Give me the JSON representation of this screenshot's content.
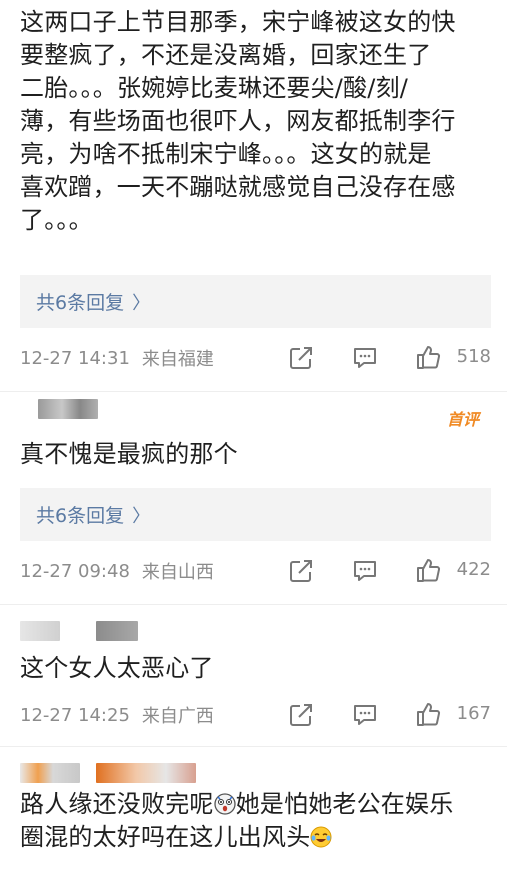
{
  "comments": [
    {
      "text_lines": [
        "这两口子上节目那季，宋宁峰被这女的快",
        "要整疯了，不还是没离婚，回家还生了",
        "二胎。。。张婉婷比麦琳还要尖/酸/刻/",
        "薄，有些场面也很吓人，网友都抵制李行",
        "亮，为啥不抵制宋宁峰。。。这女的就是",
        "喜欢蹭，一天不蹦哒就感觉自己没存在感",
        "了。。。"
      ],
      "replies": "共6条回复",
      "time": "12-27 14:31",
      "location": "来自福建",
      "likes": "518"
    },
    {
      "badge": "首评",
      "text_lines": [
        "真不愧是最疯的那个"
      ],
      "replies": "共6条回复",
      "time": "12-27 09:48",
      "location": "来自山西",
      "likes": "422"
    },
    {
      "text_lines": [
        "这个女人太恶心了"
      ],
      "time": "12-27 14:25",
      "location": "来自广西",
      "likes": "167"
    },
    {
      "text_lines": [
        "路人缘还没败完呢",
        "她是怕她老公在娱乐",
        "圈混的太好吗在这儿出风头"
      ]
    }
  ],
  "icons": {
    "share": "share-edit-icon",
    "comment": "comment-bubble-icon",
    "like": "thumbs-up-icon",
    "reply_chevron": "chevron-right-icon",
    "emoji_shocked": "shocked-face-emoji",
    "emoji_laugh": "laughing-tears-emoji"
  },
  "colors": {
    "reply_link": "#5b7aa3",
    "meta_text": "#8c8c8c",
    "badge": "#f08a24",
    "reply_box_bg": "#f3f3f3"
  }
}
